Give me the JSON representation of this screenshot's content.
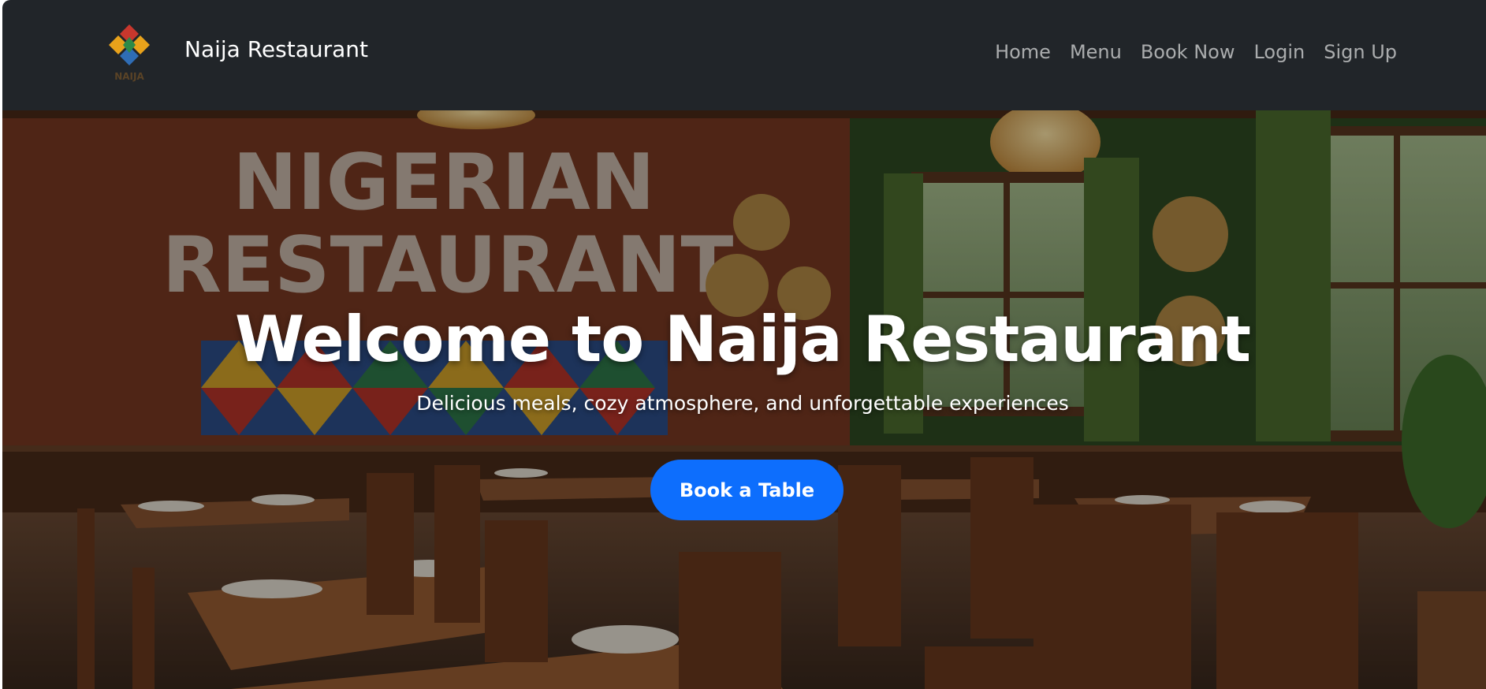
{
  "navbar": {
    "brand_name": "Naija Restaurant",
    "logo_text": "NAIJA",
    "links": [
      "Home",
      "Menu",
      "Book Now",
      "Login",
      "Sign Up"
    ]
  },
  "hero": {
    "title": "Welcome to Naija Restaurant",
    "subtitle": "Delicious meals, cozy atmosphere, and unforgettable experiences",
    "cta_label": "Book a Table",
    "wall_sign_line1": "NIGERIAN",
    "wall_sign_line2": "RESTAURANT"
  },
  "colors": {
    "navbar_bg": "#212529",
    "primary": "#0d6efd",
    "wall_left": "#7a3a22",
    "wall_right": "#2f4a22"
  }
}
